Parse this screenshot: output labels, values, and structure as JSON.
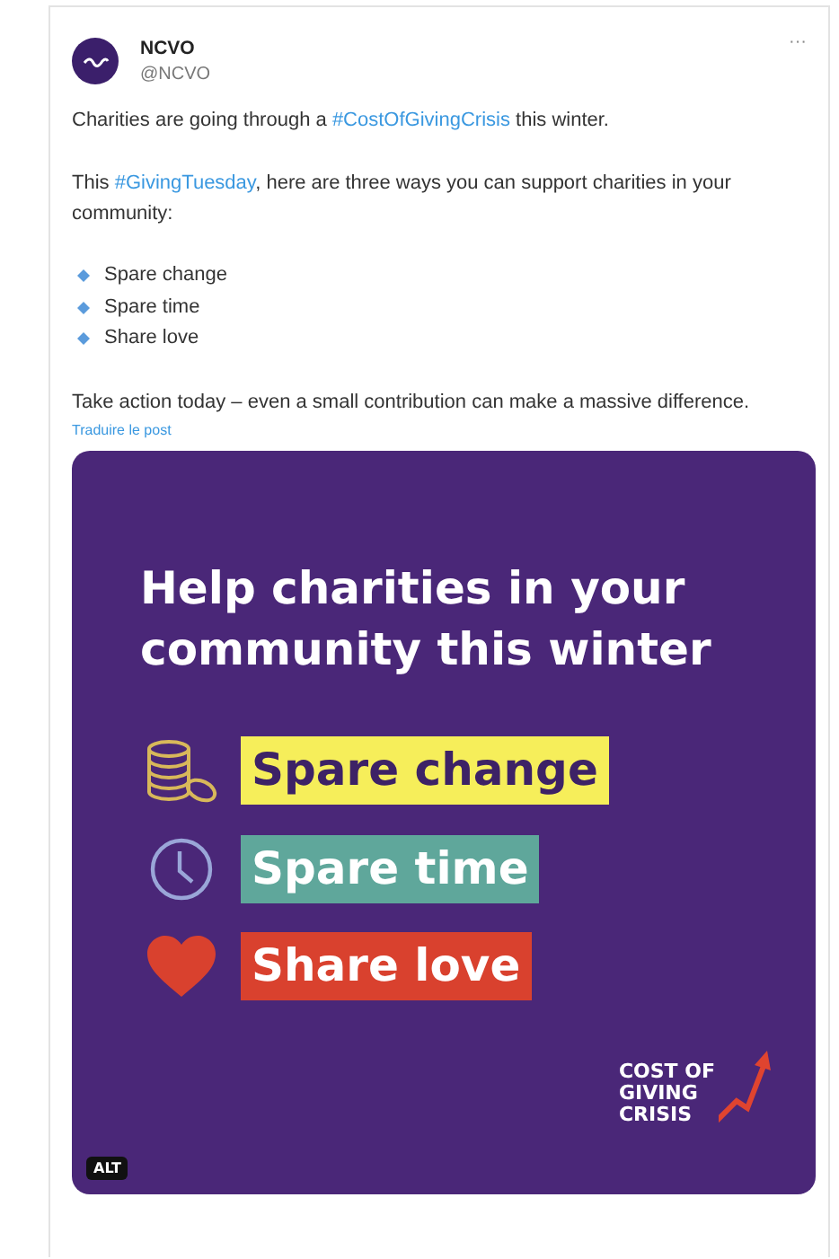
{
  "post": {
    "author": {
      "name": "NCVO",
      "handle": "@NCVO"
    },
    "more_icon": "···",
    "paragraphs": [
      [
        {
          "kind": "text",
          "text": "Charities are going through a "
        },
        {
          "kind": "hashtag",
          "text": "#CostOfGivingCrisis"
        },
        {
          "kind": "text",
          "text": " this winter."
        }
      ],
      [
        {
          "kind": "text",
          "text": "This "
        },
        {
          "kind": "hashtag",
          "text": "#GivingTuesday"
        },
        {
          "kind": "text",
          "text": ", here are three ways you can support charities in your community:"
        }
      ]
    ],
    "list": [
      "Spare change",
      "Spare time",
      "Share love"
    ],
    "closing": "Take action today – even a small contribution can make a massive difference.",
    "translate_link": "Traduire le post",
    "image": {
      "headline": "Help charities in your community this winter",
      "items": [
        {
          "kind": "coins",
          "label": "Spare change",
          "color": "#f6ee5a"
        },
        {
          "kind": "clock",
          "label": "Spare time",
          "color": "#5fa79b"
        },
        {
          "kind": "heart",
          "label": "Share love",
          "color": "#d9412e"
        }
      ],
      "logo_lines": [
        "COST OF",
        "GIVING",
        "CRISIS"
      ],
      "alt_badge": "ALT"
    }
  }
}
